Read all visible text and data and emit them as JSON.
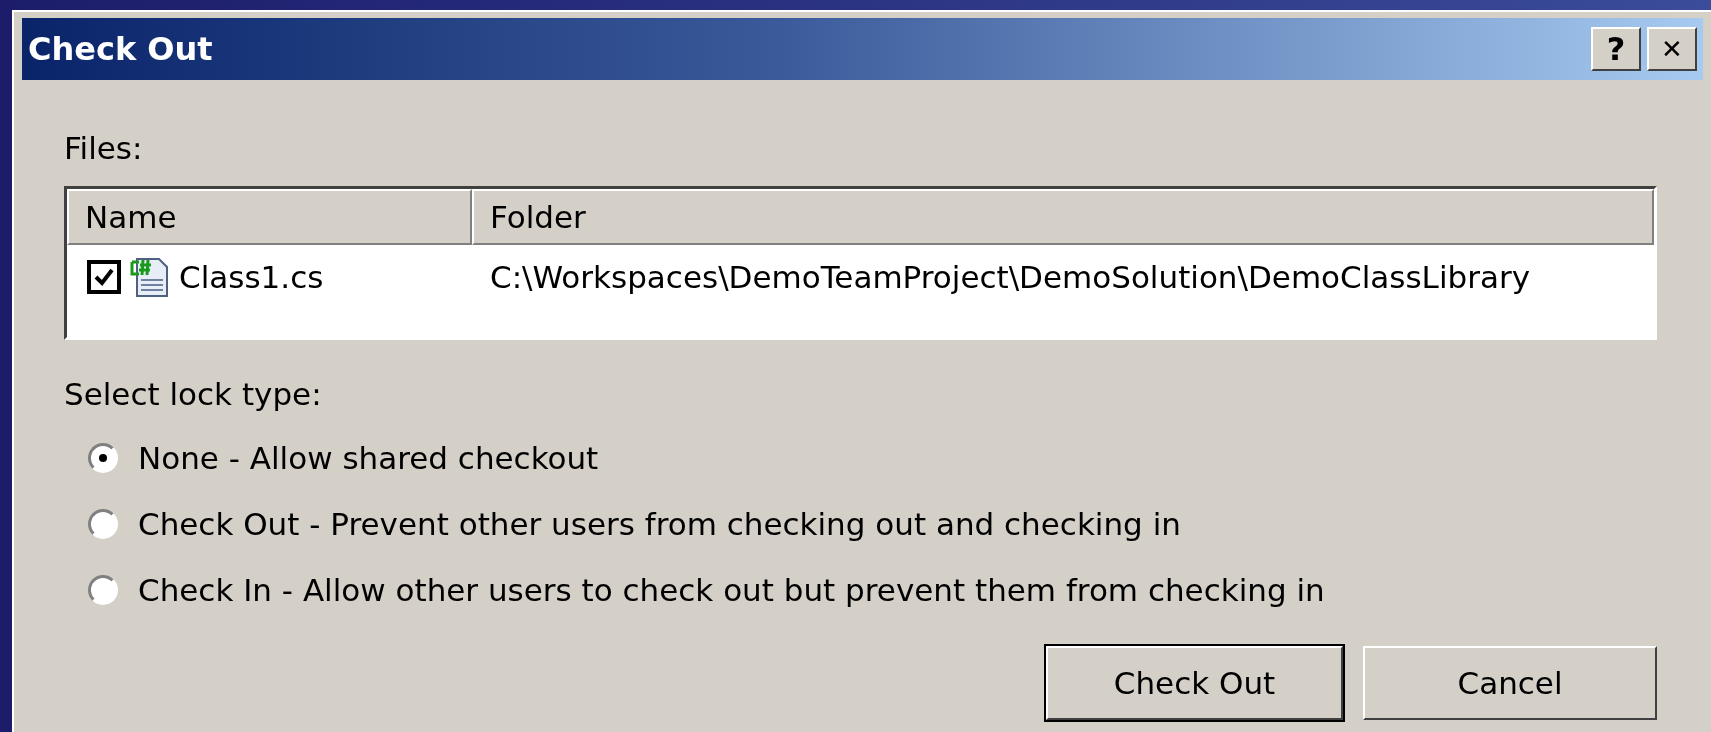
{
  "window": {
    "title": "Check Out",
    "buttons": [
      {
        "kind": "help",
        "label": "?"
      },
      {
        "kind": "close",
        "label": "✕"
      }
    ]
  },
  "files": {
    "label": "Files:",
    "columns": [
      "Name",
      "Folder"
    ],
    "rows": [
      {
        "checked": true,
        "name": "Class1.cs",
        "folder": "C:\\Workspaces\\DemoTeamProject\\DemoSolution\\DemoClassLibrary"
      }
    ]
  },
  "lock": {
    "label": "Select lock type:",
    "options": [
      {
        "label": "None - Allow shared checkout",
        "selected": true
      },
      {
        "label": "Check Out - Prevent other users from checking out and checking in",
        "selected": false
      },
      {
        "label": "Check In - Allow other users to check out but prevent them from checking in",
        "selected": false
      }
    ]
  },
  "buttons": [
    {
      "label": "Check Out",
      "default": true
    },
    {
      "label": "Cancel",
      "default": false
    }
  ]
}
